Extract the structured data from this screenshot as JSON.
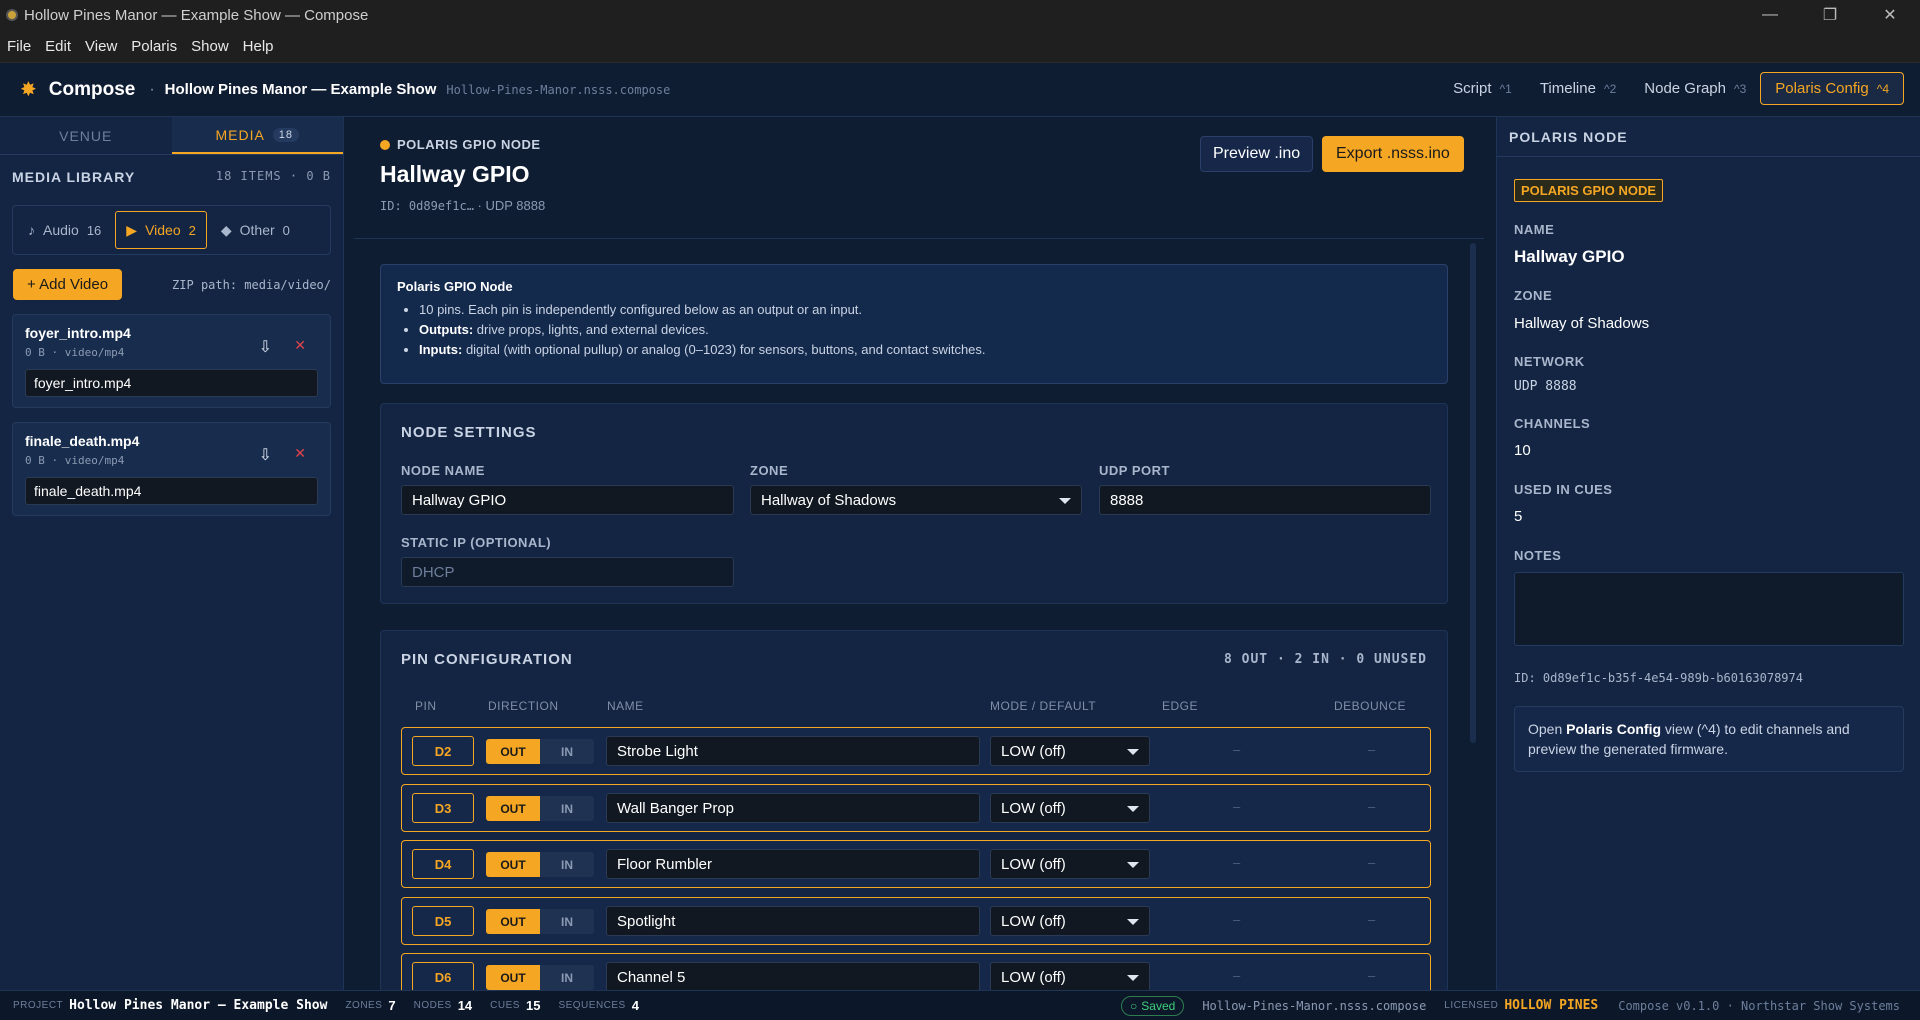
{
  "window": {
    "title": "Hollow Pines Manor — Example Show — Compose",
    "controls": [
      "—",
      "❐",
      "✕"
    ]
  },
  "menu": [
    "File",
    "Edit",
    "View",
    "Polaris",
    "Show",
    "Help"
  ],
  "header": {
    "brand": "Compose",
    "separator": "·",
    "show_title": "Hollow Pines Manor — Example Show",
    "file": "Hollow-Pines-Manor.nsss.compose",
    "tabs": [
      {
        "label": "Script",
        "key": "^1"
      },
      {
        "label": "Timeline",
        "key": "^2"
      },
      {
        "label": "Node Graph",
        "key": "^3"
      },
      {
        "label": "Polaris Config",
        "key": "^4",
        "active": true
      }
    ]
  },
  "left": {
    "tabs": [
      {
        "label": "VENUE"
      },
      {
        "label": "MEDIA",
        "badge": "18",
        "active": true
      }
    ],
    "library_title": "MEDIA LIBRARY",
    "library_count": "18 ITEMS · 0 B",
    "filters": [
      {
        "icon": "♪",
        "label": "Audio",
        "count": "16"
      },
      {
        "icon": "▶",
        "label": "Video",
        "count": "2",
        "active": true
      },
      {
        "icon": "◆",
        "label": "Other",
        "count": "0"
      }
    ],
    "add_button": "+ Add Video",
    "zip_path": "ZIP path: media/video/",
    "items": [
      {
        "name": "foyer_intro.mp4",
        "meta": "0 B · video/mp4",
        "value": "foyer_intro.mp4"
      },
      {
        "name": "finale_death.mp4",
        "meta": "0 B · video/mp4",
        "value": "finale_death.mp4"
      }
    ]
  },
  "node": {
    "tag": "POLARIS GPIO NODE",
    "title": "Hallway GPIO",
    "id_short": "ID: 0d89ef1c…",
    "udp": "· UDP 8888",
    "preview_button": "Preview .ino",
    "export_button": "Export .nsss.ino",
    "info_title": "Polaris GPIO Node",
    "info_lines": [
      {
        "bold": "",
        "text": "10 pins. Each pin is independently configured below as an output or an input."
      },
      {
        "bold": "Outputs:",
        "text": " drive props, lights, and external devices."
      },
      {
        "bold": "Inputs:",
        "text": " digital (with optional pullup) or analog (0–1023) for sensors, buttons, and contact switches."
      }
    ]
  },
  "settings": {
    "title": "NODE SETTINGS",
    "name_label": "NODE NAME",
    "name_value": "Hallway GPIO",
    "zone_label": "ZONE",
    "zone_value": "Hallway of Shadows",
    "port_label": "UDP PORT",
    "port_value": "8888",
    "ip_label": "STATIC IP (OPTIONAL)",
    "ip_placeholder": "DHCP"
  },
  "pins": {
    "title": "PIN CONFIGURATION",
    "summary": "8 OUT · 2 IN · 0 UNUSED",
    "columns": [
      "PIN",
      "DIRECTION",
      "NAME",
      "MODE / DEFAULT",
      "EDGE",
      "DEBOUNCE"
    ],
    "out_label": "OUT",
    "in_label": "IN",
    "rows": [
      {
        "pin": "D2",
        "name": "Strobe Light",
        "mode": "LOW (off)",
        "edge": "–",
        "debounce": "–"
      },
      {
        "pin": "D3",
        "name": "Wall Banger Prop",
        "mode": "LOW (off)",
        "edge": "–",
        "debounce": "–"
      },
      {
        "pin": "D4",
        "name": "Floor Rumbler",
        "mode": "LOW (off)",
        "edge": "–",
        "debounce": "–"
      },
      {
        "pin": "D5",
        "name": "Spotlight",
        "mode": "LOW (off)",
        "edge": "–",
        "debounce": "–"
      },
      {
        "pin": "D6",
        "name": "Channel 5",
        "mode": "LOW (off)",
        "edge": "–",
        "debounce": "–"
      }
    ]
  },
  "right": {
    "title": "POLARIS NODE",
    "badge": "POLARIS GPIO NODE",
    "name_label": "NAME",
    "name": "Hallway GPIO",
    "zone_label": "ZONE",
    "zone": "Hallway of Shadows",
    "network_label": "NETWORK",
    "network": "UDP 8888",
    "channels_label": "CHANNELS",
    "channels": "10",
    "cues_label": "USED IN CUES",
    "cues": "5",
    "notes_label": "NOTES",
    "id": "ID: 0d89ef1c-b35f-4e54-989b-b60163078974",
    "hint_pre": "Open ",
    "hint_bold": "Polaris Config",
    "hint_post": " view (^4) to edit channels and preview the generated firmware."
  },
  "status": {
    "project_label": "PROJECT",
    "project": "Hollow Pines Manor — Example Show",
    "zones_label": "ZONES",
    "zones": "7",
    "nodes_label": "NODES",
    "nodes": "14",
    "cues_label": "CUES",
    "cues": "15",
    "sequences_label": "SEQUENCES",
    "sequences": "4",
    "saved": "Saved",
    "file": "Hollow-Pines-Manor.nsss.compose",
    "licensed_label": "LICENSED",
    "licensed": "HOLLOW PINES",
    "version": "Compose v0.1.0 · Northstar Show Systems"
  },
  "colors": {
    "accent": "#f5a623",
    "background": "#0f1d33",
    "panel": "#132543",
    "danger": "#e0434c",
    "success": "#3ecf7a"
  }
}
